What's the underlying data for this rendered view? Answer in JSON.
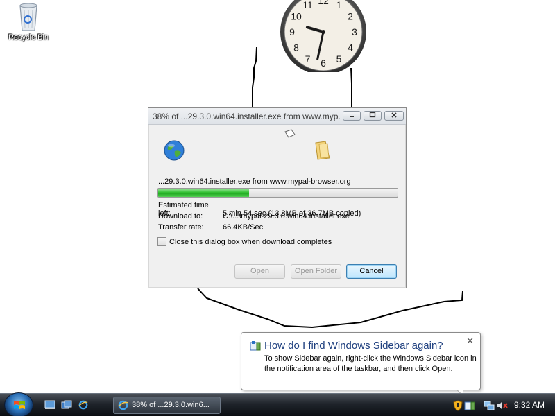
{
  "desktop": {
    "recycle_bin_label": "Recycle Bin"
  },
  "dialog": {
    "title": "38% of ...29.3.0.win64.installer.exe from www.myp...",
    "filename_line": "...29.3.0.win64.installer.exe from www.mypal-browser.org",
    "progress_fraction": 0.38,
    "estimated_label": "Estimated time left:",
    "estimated_value": "5 min 54 sec (13.8MB of 36.7MB copied)",
    "download_to_label": "Download to:",
    "download_to_value": "C:\\...\\mypal-29.3.0.win64.installer.exe",
    "rate_label": "Transfer rate:",
    "rate_value": "66.4KB/Sec",
    "close_checkbox_label": "Close this dialog box when download completes",
    "close_checkbox_checked": false,
    "open_label": "Open",
    "open_folder_label": "Open Folder",
    "cancel_label": "Cancel"
  },
  "balloon": {
    "title": "How do I find Windows Sidebar again?",
    "body": "To show Sidebar again, right-click the Windows Sidebar icon in the notification area of the taskbar, and then click Open.",
    "close_glyph": "✕"
  },
  "taskbar": {
    "task_label": "38% of ...29.3.0.win6...",
    "time": "9:32 AM"
  },
  "clock_gadget": {
    "hour": 9,
    "minute": 32,
    "numbers": [
      "12",
      "1",
      "2",
      "3",
      "4",
      "5",
      "6",
      "7",
      "8",
      "9",
      "10",
      "11"
    ]
  },
  "colors": {
    "progress_fill": "#37c337",
    "balloon_title": "#1e3f7f",
    "taskbar": "#1f242b"
  }
}
